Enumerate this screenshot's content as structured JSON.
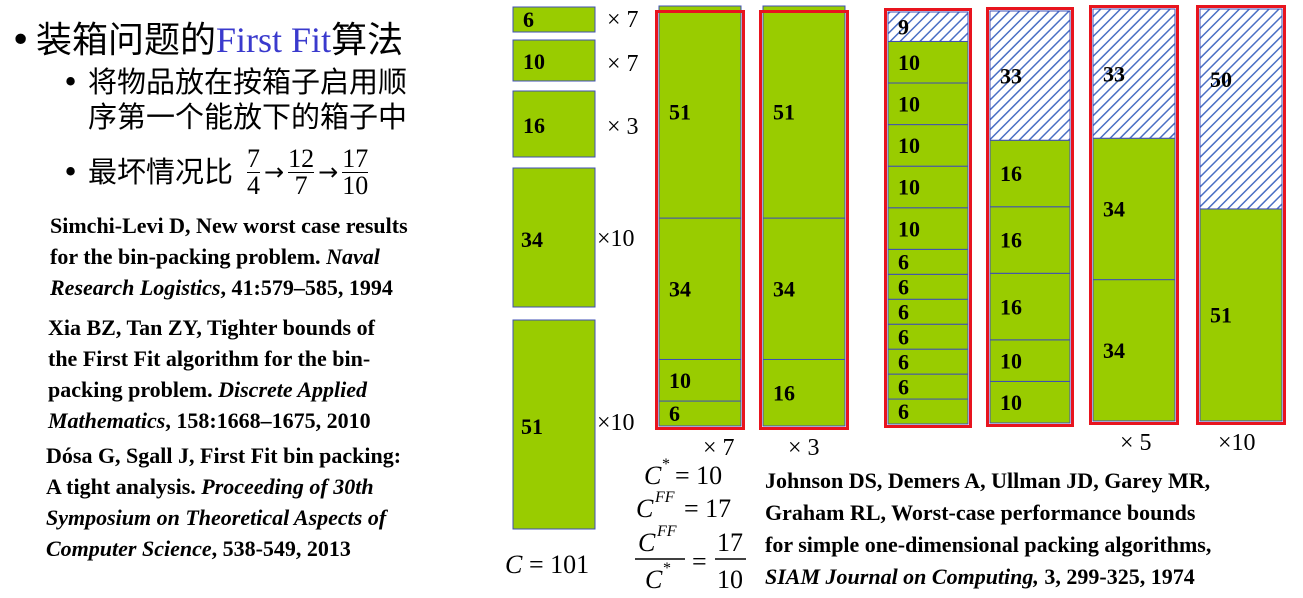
{
  "heading": {
    "prefix": "装箱问题的",
    "highlight": "First Fit",
    "suffix": "算法"
  },
  "bullets": {
    "rule_line1": "将物品放在按箱子启用顺",
    "rule_line2": "序第一个能放下的箱子中",
    "worst_label": "最坏情况比",
    "ratios": [
      {
        "num": "7",
        "den": "4"
      },
      {
        "num": "12",
        "den": "7"
      },
      {
        "num": "17",
        "den": "10"
      }
    ]
  },
  "references": [
    {
      "l1": "Simchi-Levi D, New worst case results",
      "l2": "for the bin-packing problem. ",
      "l2i": "Naval",
      "l3i": "Research Logistics",
      "l3": ", 41:579–585, 1994"
    },
    {
      "l1": "Xia BZ, Tan ZY, Tighter bounds of",
      "l2": "the First Fit algorithm for the bin-",
      "l3": "packing problem. ",
      "l3i": "Discrete Applied",
      "l4i": "Mathematics",
      "l4": ", 158:1668–1675, 2010"
    },
    {
      "l1": "Dósa G, Sgall J, First Fit bin packing:",
      "l2": "A tight analysis. ",
      "l2i": "Proceeding of 30th",
      "l3i": "Symposium on Theoretical Aspects of",
      "l4i": "Computer Science",
      "l4": ", 538-549, 2013"
    },
    {
      "l1": "Johnson DS, Demers A, Ullman JD, Garey MR,",
      "l2": "Graham RL, Worst-case performance bounds",
      "l3": "for simple one-dimensional packing algorithms,",
      "l4i": "SIAM Journal on Computing,",
      "l4": " 3, 299-325, 1974"
    }
  ],
  "items": [
    {
      "size": "6",
      "mult": "× 7"
    },
    {
      "size": "10",
      "mult": "× 7"
    },
    {
      "size": "16",
      "mult": "× 3"
    },
    {
      "size": "34",
      "mult": "×10"
    },
    {
      "size": "51",
      "mult": "×10"
    }
  ],
  "total": {
    "C": "C",
    "eq": "= 101"
  },
  "bins": [
    {
      "mult": "× 7",
      "pieces": [
        "51",
        "34",
        "10",
        "6"
      ]
    },
    {
      "mult": "× 3",
      "pieces": [
        "51",
        "34",
        "16"
      ]
    },
    {
      "mult": "",
      "empty": "9",
      "pieces": [
        "10",
        "10",
        "10",
        "10",
        "10",
        "6",
        "6",
        "6",
        "6",
        "6",
        "6",
        "6"
      ]
    },
    {
      "mult": "",
      "empty": "33",
      "pieces": [
        "16",
        "16",
        "16",
        "10",
        "10"
      ]
    },
    {
      "mult": "× 5",
      "empty": "33",
      "pieces": [
        "34",
        "34"
      ]
    },
    {
      "mult": "×10",
      "empty": "50",
      "pieces": [
        "51"
      ]
    }
  ],
  "results": {
    "cstar": "C",
    "cstar_sup": "*",
    "cstar_val": "= 10",
    "cff": "C",
    "cff_sup": "FF",
    "cff_val": "= 17",
    "ratio_eq": "=",
    "ratio_num": "17",
    "ratio_den": "10"
  },
  "colors": {
    "fill": "#99cc00",
    "bin_border": "#e8141e",
    "piece_border": "#3f4fb5",
    "hatch": "#4a6fc4",
    "highlight": "#3a3acd"
  }
}
